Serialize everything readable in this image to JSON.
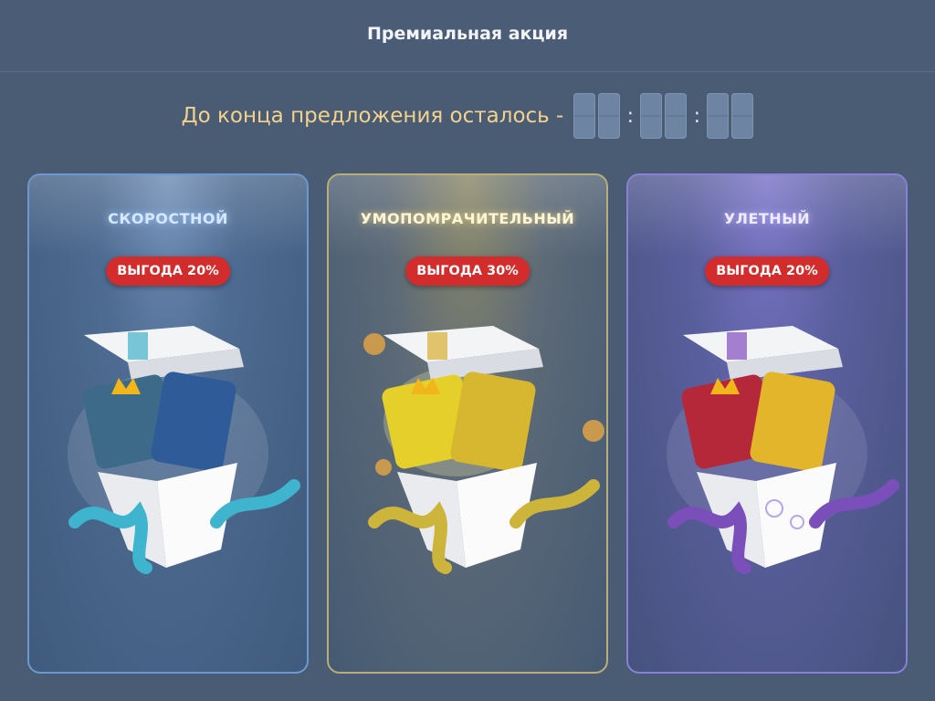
{
  "header": {
    "title": "Премиальная акция"
  },
  "timer": {
    "label": "До конца предложения осталось -",
    "separator": ":"
  },
  "offers": [
    {
      "title": "СКОРОСТНОЙ",
      "badge": "ВЫГОДА 20%",
      "accent": "#3fb4cf"
    },
    {
      "title": "УМОПОМРАЧИТЕЛЬНЫЙ",
      "badge": "ВЫГОДА 30%",
      "accent": "#cdb43a"
    },
    {
      "title": "УЛЕТНЫЙ",
      "badge": "ВЫГОДА 20%",
      "accent": "#7b4fb9"
    }
  ],
  "colors": {
    "badge": "#d22c2c",
    "timer_label": "#f2d28e"
  }
}
